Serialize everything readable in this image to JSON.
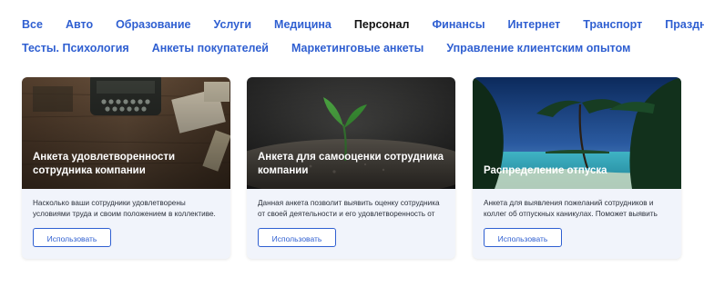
{
  "categories_row1": [
    "Все",
    "Авто",
    "Образование",
    "Услуги",
    "Медицина",
    "Персонал",
    "Финансы",
    "Интернет",
    "Транспорт",
    "Праздники"
  ],
  "categories_row2": [
    "Тесты. Психология",
    "Анкеты покупателей",
    "Маркетинговые анкеты",
    "Управление клиентским опытом"
  ],
  "active_category": "Персонал",
  "cards": [
    {
      "title": "Анкета удовлетворенности сотрудника компании",
      "description": "Насколько ваши сотрудники удовлетворены условиями труда и своим положением в коллективе.",
      "button": "Использовать",
      "image": "typewriter-desk-photo"
    },
    {
      "title": "Анкета для самооценки сотрудника компании",
      "description": "Данная анкета позволит выявить оценку сотрудника от своей деятельности и его удовлетворенность от",
      "button": "Использовать",
      "image": "sprout-photo"
    },
    {
      "title": "Распределение отпуска",
      "description": "Анкета для выявления пожеланий сотрудников и коллег об отпускных каникулах. Поможет выявить",
      "button": "Использовать",
      "image": "tropical-beach-photo"
    }
  ],
  "colors": {
    "link": "#2f5fd1",
    "active": "#111111",
    "card_bg": "#f1f4fb"
  }
}
